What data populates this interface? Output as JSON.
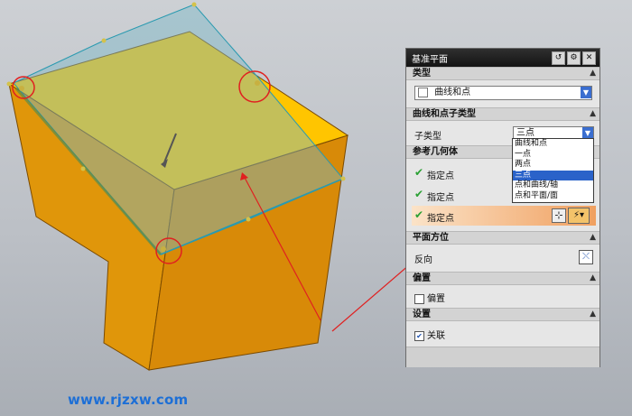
{
  "watermark": "www.rjzxw.com",
  "dialog": {
    "title": "基准平面",
    "sections": {
      "type": "类型",
      "curve_point_subtype": "曲线和点子类型",
      "ref_geometry": "参考几何体",
      "plane_orientation": "平面方位",
      "offset": "偏置",
      "settings": "设置"
    },
    "type_value": "曲线和点",
    "subtype_label": "子类型",
    "subtype_value": "三点",
    "subtype_options": [
      "曲线和点",
      "一点",
      "两点",
      "三点",
      "点和曲线/轴",
      "点和平面/面"
    ],
    "subtype_selected_index": 3,
    "specify_point_1": "指定点",
    "specify_point_2": "指定点",
    "specify_point_3": "指定点",
    "reverse_label": "反向",
    "offset_checkbox": "偏置",
    "offset_checked": false,
    "associative_checkbox": "关联",
    "associative_checked": true
  },
  "colors": {
    "box_side": "#e0960a",
    "box_top": "#ffc500",
    "plane": "#7ab8c8",
    "annotation_red": "#e02020",
    "highlight_orange": "#f0a060",
    "accent_blue": "#2a62c9"
  }
}
